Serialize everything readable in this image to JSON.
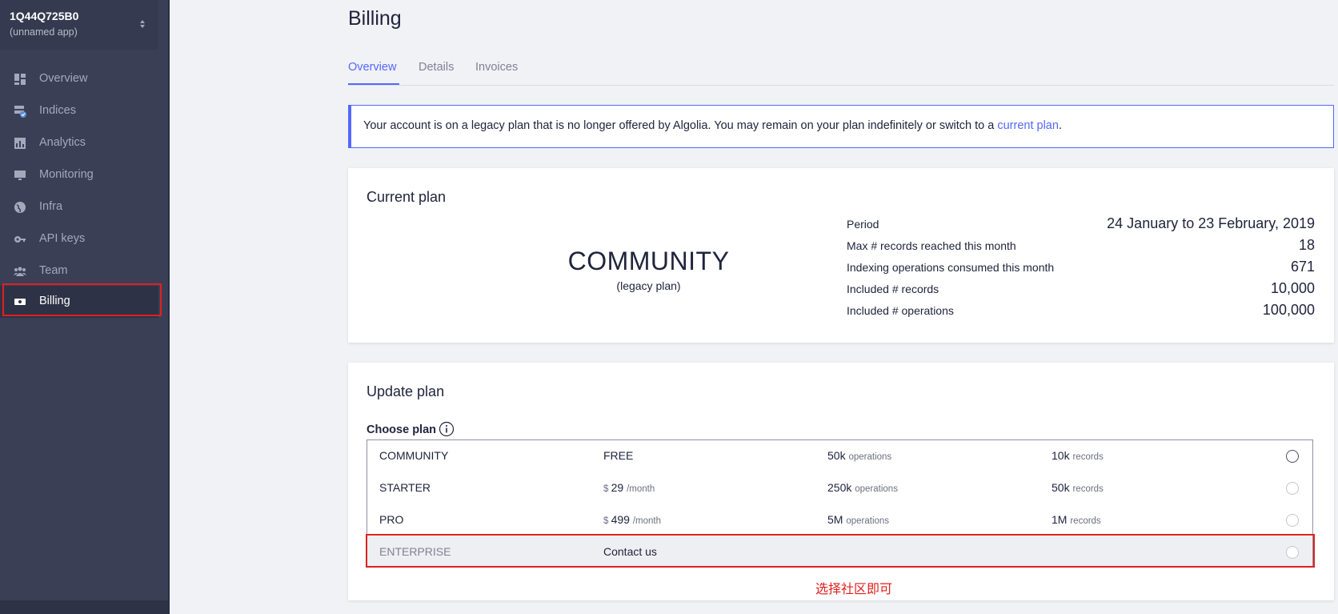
{
  "app": {
    "id": "1Q44Q725B0",
    "name": "(unnamed app)"
  },
  "sidebar": {
    "items": [
      {
        "label": "Overview",
        "icon": "dashboard-icon"
      },
      {
        "label": "Indices",
        "icon": "indices-icon"
      },
      {
        "label": "Analytics",
        "icon": "bar-chart-icon"
      },
      {
        "label": "Monitoring",
        "icon": "monitor-icon"
      },
      {
        "label": "Infra",
        "icon": "globe-icon"
      },
      {
        "label": "API keys",
        "icon": "key-icon"
      },
      {
        "label": "Team",
        "icon": "team-icon"
      },
      {
        "label": "Billing",
        "icon": "money-icon",
        "active": true
      }
    ]
  },
  "page": {
    "title": "Billing"
  },
  "tabs": [
    {
      "label": "Overview",
      "active": true
    },
    {
      "label": "Details",
      "active": false
    },
    {
      "label": "Invoices",
      "active": false
    }
  ],
  "notice": {
    "text": "Your account is on a legacy plan that is no longer offered by Algolia. You may remain on your plan indefinitely or switch to a ",
    "link_text": "current plan",
    "suffix": "."
  },
  "current_plan": {
    "title": "Current plan",
    "name": "COMMUNITY",
    "note": "(legacy plan)",
    "stats": [
      {
        "label": "Period",
        "value": "24 January to 23 February, 2019"
      },
      {
        "label": "Max # records reached this month",
        "value": "18"
      },
      {
        "label": "Indexing operations consumed this month",
        "value": "671"
      },
      {
        "label": "Included # records",
        "value": "10,000"
      },
      {
        "label": "Included # operations",
        "value": "100,000"
      }
    ]
  },
  "update_plan": {
    "title": "Update plan",
    "choose_label": "Choose plan",
    "plans": [
      {
        "name": "COMMUNITY",
        "price": "FREE",
        "price_prefix": "",
        "price_unit": "",
        "ops": "50k",
        "ops_unit": "operations",
        "records": "10k",
        "records_unit": "records",
        "selected": false
      },
      {
        "name": "STARTER",
        "price": "29",
        "price_prefix": "$ ",
        "price_unit": "/month",
        "ops": "250k",
        "ops_unit": "operations",
        "records": "50k",
        "records_unit": "records",
        "selected": false
      },
      {
        "name": "PRO",
        "price": "499",
        "price_prefix": "$ ",
        "price_unit": "/month",
        "ops": "5M",
        "ops_unit": "operations",
        "records": "1M",
        "records_unit": "records",
        "selected": false
      },
      {
        "name": "ENTERPRISE",
        "price": "Contact us",
        "price_prefix": "",
        "price_unit": "",
        "ops": "",
        "ops_unit": "",
        "records": "",
        "records_unit": "",
        "selected": false
      }
    ]
  },
  "annotation": {
    "text": "选择社区即可"
  },
  "colors": {
    "accent": "#5468ff",
    "sidebar": "#3a3f56",
    "highlight": "#e0201d"
  }
}
